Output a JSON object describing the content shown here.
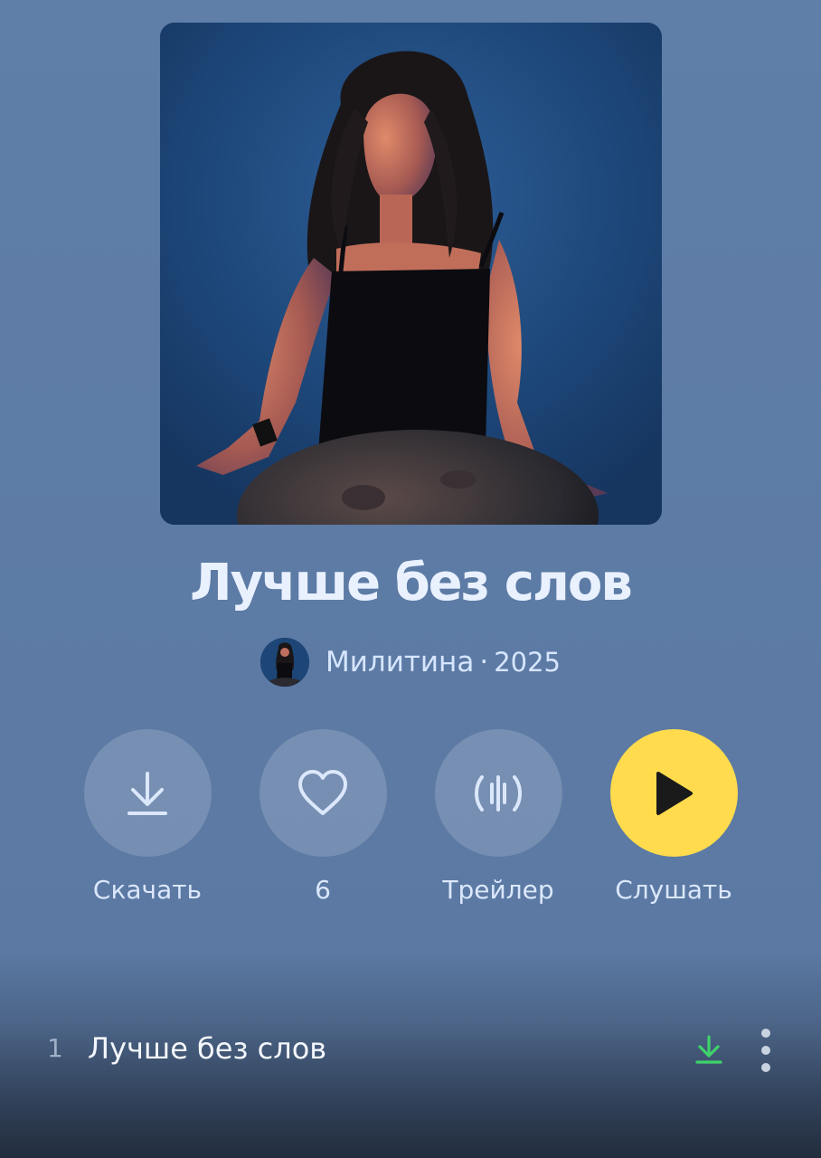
{
  "album": {
    "title": "Лучше без слов",
    "artist": "Милитина",
    "separator": "·",
    "year": "2025"
  },
  "actions": {
    "download_label": "Скачать",
    "likes_count": "6",
    "trailer_label": "Трейлер",
    "listen_label": "Слушать"
  },
  "tracks": [
    {
      "number": "1",
      "title": "Лучше без слов"
    }
  ],
  "colors": {
    "accent_play": "#ffdb4d",
    "download_done": "#3fd26a",
    "background": "#5f7ea8"
  },
  "icons": {
    "download": "download-icon",
    "like": "heart-icon",
    "trailer": "waveform-icon",
    "play": "play-icon",
    "more": "more-vertical-icon"
  }
}
